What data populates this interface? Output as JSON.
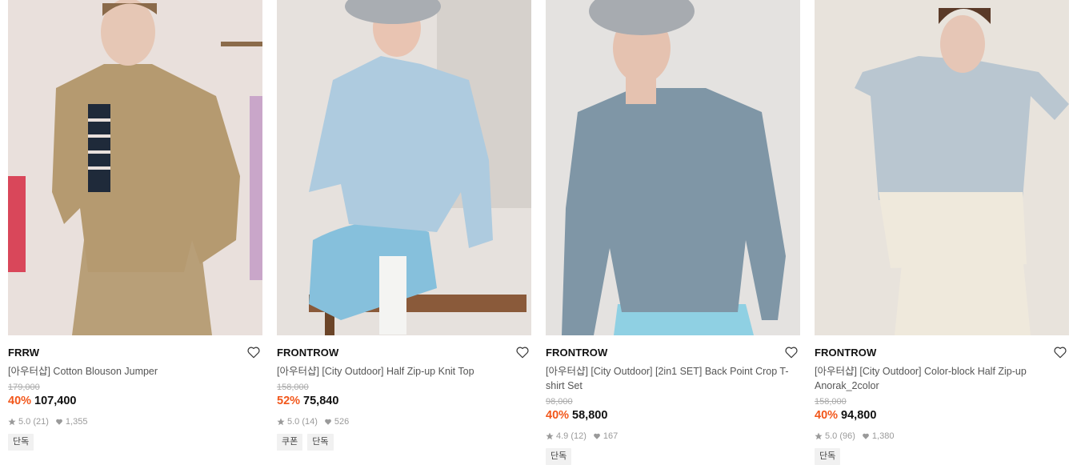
{
  "products": [
    {
      "brand": "FRRW",
      "name": "[아우터샵] Cotton Blouson Jumper",
      "original_price": "179,000",
      "discount": "40%",
      "price": "107,400",
      "rating": "5.0",
      "reviews": "(21)",
      "likes": "1,355",
      "tags": [
        "단독"
      ],
      "colors": {
        "bg": "#e9e0dc",
        "garment": "#b59a70",
        "bottom": "#b89f78",
        "skin": "#e6c7b5"
      }
    },
    {
      "brand": "FRONTROW",
      "name": "[아우터샵] [City Outdoor] Half Zip-up Knit Top",
      "original_price": "158,000",
      "discount": "52%",
      "price": "75,840",
      "rating": "5.0",
      "reviews": "(14)",
      "likes": "526",
      "tags": [
        "쿠폰",
        "단독"
      ],
      "colors": {
        "bg": "#e6e1dd",
        "garment": "#aecbdf",
        "bottom": "#86c0dc",
        "skin": "#e9c4b2"
      }
    },
    {
      "brand": "FRONTROW",
      "name": "[아우터샵] [City Outdoor] [2in1 SET] Back Point Crop T-shirt Set",
      "original_price": "98,000",
      "discount": "40%",
      "price": "58,800",
      "rating": "4.9",
      "reviews": "(12)",
      "likes": "167",
      "tags": [
        "단독"
      ],
      "colors": {
        "bg": "#e4e2e0",
        "garment": "#7f96a6",
        "bottom": "#8fd0e3",
        "skin": "#e5c2b0"
      }
    },
    {
      "brand": "FRONTROW",
      "name": "[아우터샵] [City Outdoor] Color-block Half Zip-up Anorak_2color",
      "original_price": "158,000",
      "discount": "40%",
      "price": "94,800",
      "rating": "5.0",
      "reviews": "(96)",
      "likes": "1,380",
      "tags": [
        "단독"
      ],
      "colors": {
        "bg": "#e8e3dc",
        "garment": "#b9c6d0",
        "bottom": "#efe9dc",
        "skin": "#e6c6b6"
      }
    }
  ]
}
